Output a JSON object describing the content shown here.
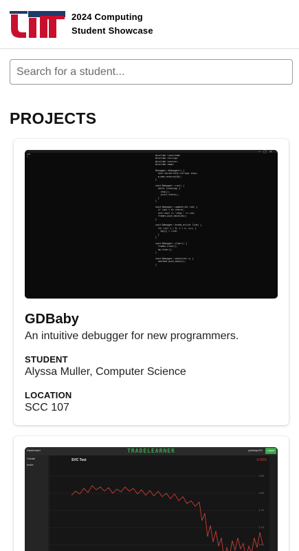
{
  "header": {
    "title_line1": "2024 Computing",
    "title_line2": "Student Showcase"
  },
  "search": {
    "placeholder": "Search for a student..."
  },
  "section_title": "PROJECTS",
  "colors": {
    "logo_red": "#c8102e",
    "logo_blue": "#1f3a6b",
    "accent_green": "#3aa64a",
    "chart_line": "#e0413b"
  },
  "labels": {
    "student": "STUDENT",
    "location": "LOCATION"
  },
  "projects": [
    {
      "name": "GDBaby",
      "description": "An intuitive debugger for new programmers.",
      "student": "Alyssa Muller, Computer Science",
      "location": "SCC 107"
    },
    {
      "screenshot": {
        "brand": "TRADELEARNER",
        "tab": "Dashboard",
        "user": "jackbap202",
        "logout": "Logout",
        "sidebar": [
          "Create",
          "Invite"
        ],
        "symbol": "SVC Test",
        "change": "-0.00%"
      }
    }
  ]
}
